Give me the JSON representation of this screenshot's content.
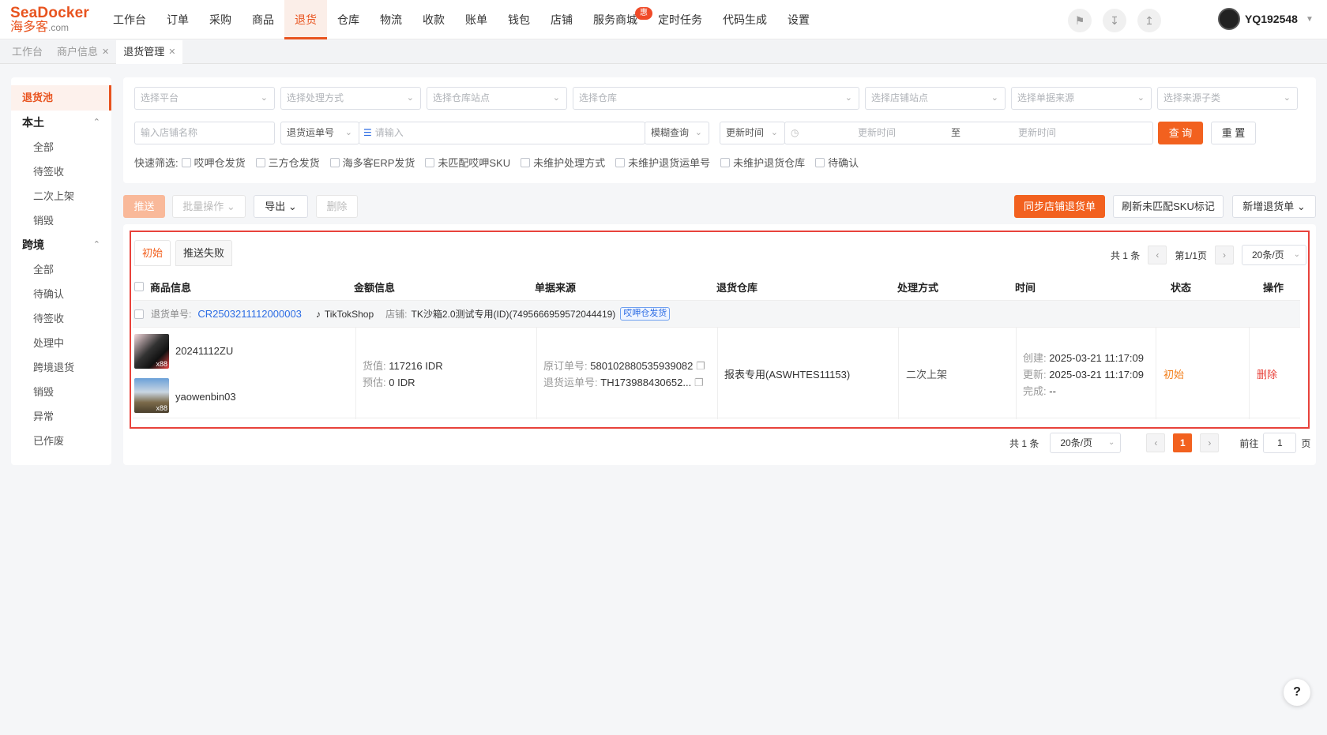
{
  "logo": {
    "line1": "SeaDocker",
    "line2": "海多客",
    "suffix": ".com"
  },
  "nav": {
    "items": [
      "工作台",
      "订单",
      "采购",
      "商品",
      "退货",
      "仓库",
      "物流",
      "收款",
      "账单",
      "钱包",
      "店铺",
      "服务商城",
      "定时任务",
      "代码生成",
      "设置"
    ],
    "active": "退货",
    "badge": "惠"
  },
  "user": {
    "name": "YQ192548"
  },
  "page_tabs": [
    {
      "label": "工作台",
      "closable": false
    },
    {
      "label": "商户信息",
      "closable": true
    },
    {
      "label": "退货管理",
      "closable": true
    }
  ],
  "sidebar": {
    "active": "退货池",
    "groups": [
      {
        "label": "本土",
        "items": [
          "全部",
          "待签收",
          "二次上架",
          "销毁"
        ]
      },
      {
        "label": "跨境",
        "items": [
          "全部",
          "待确认",
          "待签收",
          "处理中",
          "跨境退货",
          "销毁",
          "异常",
          "已作废"
        ]
      }
    ]
  },
  "filters": {
    "platform": "选择平台",
    "process_method": "选择处理方式",
    "warehouse_site": "选择仓库站点",
    "warehouse": "选择仓库",
    "shop_site": "选择店铺站点",
    "doc_source": "选择单据来源",
    "source_sub": "选择来源子类",
    "shop_name_placeholder": "输入店铺名称",
    "search_field": "退货运单号",
    "search_placeholder": "请输入",
    "match_mode": "模糊查询",
    "time_field": "更新时间",
    "time_start": "更新时间",
    "time_to": "至",
    "time_end": "更新时间",
    "query": "查 询",
    "reset": "重 置",
    "quick_label": "快速筛选:",
    "quick_items": [
      "哎呷仓发货",
      "三方仓发货",
      "海多客ERP发货",
      "未匹配哎呷SKU",
      "未维护处理方式",
      "未维护退货运单号",
      "未维护退货仓库",
      "待确认"
    ]
  },
  "toolbar": {
    "push": "推送",
    "batch": "批量操作",
    "export": "导出",
    "delete": "删除",
    "sync": "同步店铺退货单",
    "refresh_sku": "刷新未匹配SKU标记",
    "new_return": "新增退货单"
  },
  "inner_tabs": [
    "初始",
    "推送失败"
  ],
  "pager_top": {
    "total": "共 1 条",
    "page": "第1/1页",
    "size": "20条/页"
  },
  "columns": [
    "商品信息",
    "金额信息",
    "单据来源",
    "退货仓库",
    "处理方式",
    "时间",
    "状态",
    "操作"
  ],
  "order": {
    "no_label": "退货单号:",
    "no": "CR2503211112000003",
    "platform": "TikTokShop",
    "shop_label": "店铺:",
    "shop": "TK沙箱2.0测试专用(ID)(7495666959572044419)",
    "tag": "哎呷仓发货"
  },
  "row": {
    "products": [
      {
        "name": "20241112ZU",
        "count": "x88"
      },
      {
        "name": "yaowenbin03",
        "count": "x88"
      }
    ],
    "amount": {
      "goods_label": "货值:",
      "goods": "117216 IDR",
      "est_label": "预估:",
      "est": "0 IDR"
    },
    "source": {
      "orig_label": "原订单号:",
      "orig": "580102880535939082",
      "track_label": "退货运单号:",
      "track": "TH173988430652..."
    },
    "warehouse": "报表专用(ASWHTES11153)",
    "method": "二次上架",
    "time": {
      "created_label": "创建:",
      "created": "2025-03-21 11:17:09",
      "updated_label": "更新:",
      "updated": "2025-03-21 11:17:09",
      "done_label": "完成:",
      "done": "--"
    },
    "status": "初始",
    "action": "删除"
  },
  "pager_bottom": {
    "total": "共 1 条",
    "size": "20条/页",
    "current": "1",
    "goto_label": "前往",
    "goto_value": "1",
    "page_unit": "页"
  },
  "help": "?",
  "colors": {
    "brand": "#e8531e",
    "button": "#f2611f",
    "link": "#2d6de4",
    "highlight_border": "#e8423b"
  }
}
